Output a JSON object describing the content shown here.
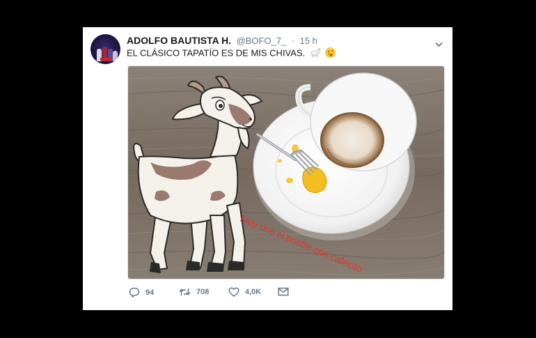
{
  "tweet": {
    "author_name": "ADOLFO BAUTISTA H.",
    "handle": "@BOFO_7_",
    "separator": "·",
    "time": "15 h",
    "text": "EL CLÁSICO TAPATÍO ES DE  MIS CHIVAS.",
    "text_emojis": [
      "goat-emoji",
      "winking-face-tongue-emoji"
    ],
    "image_caption": "Muy rico el postre con cafecito",
    "image_caption_color": "#e8322b"
  },
  "actions": {
    "reply_count": "94",
    "retweet_count": "708",
    "like_count": "4,0K"
  },
  "colors": {
    "text": "#14171a",
    "muted": "#657786",
    "background": "#000000",
    "card": "#ffffff"
  }
}
